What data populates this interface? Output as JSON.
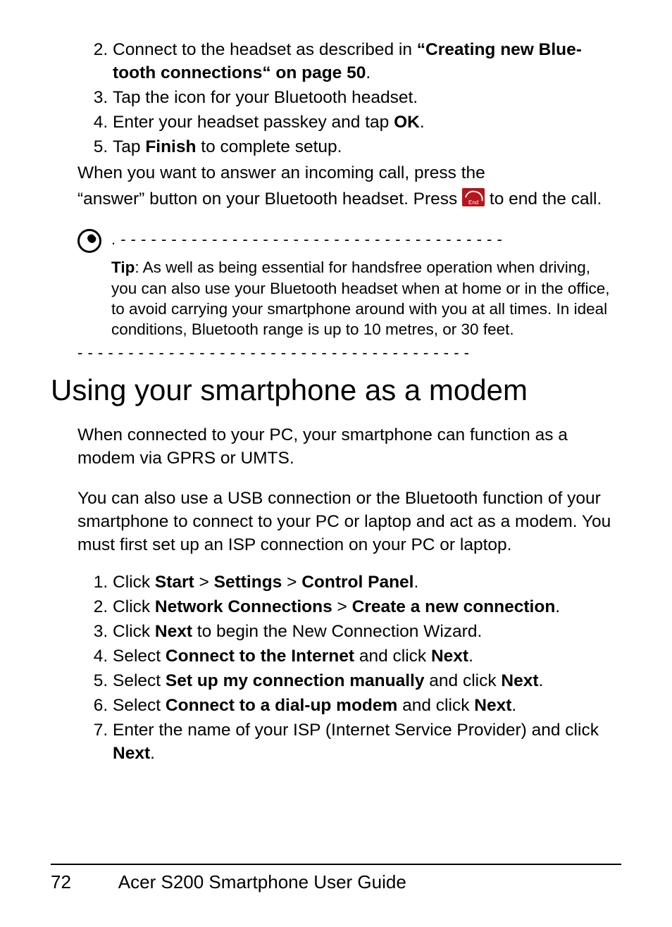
{
  "steps_top": {
    "s2_pre": "Connect to the headset as described in ",
    "s2_bold": "“Creating new Blue­tooth connections“ on page 50",
    "s2_post": ".",
    "s3": "Tap the icon for your Bluetooth headset.",
    "s4_pre": "Enter your headset passkey and tap ",
    "s4_bold": "OK",
    "s4_post": ".",
    "s5_pre": "Tap ",
    "s5_bold": "Finish",
    "s5_post": " to complete setup."
  },
  "paras": {
    "p1": "When you want to answer an incoming call, press the",
    "p2_pre": "“answer” button on your Bluetooth headset. Press ",
    "p2_post": " to end the call."
  },
  "tip": {
    "dashes_top": ". - - - - - - - - - - - - - - - - - - - - - - - - - - - - - - - - - - - - - -",
    "label": "Tip",
    "body": ": As well as being essential for handsfree operation when driv­ing, you can also use your Bluetooth headset when at home or in the office, to avoid carrying your smartphone around with you at all times. In ideal conditions, Bluetooth range is up to 10 metres, or 30 feet.",
    "dashes_bot": "- - - - - - - - - - - - - - - - - - - - - - - - - - - - - - - - - - - - - - -"
  },
  "heading": "Using your smartphone as a modem",
  "modem": {
    "p1": "When connected to your PC, your smartphone can function as a modem via GPRS or UMTS.",
    "p2": "You can also use a USB connection or the Bluetooth function of your smartphone to connect to your PC or laptop and act as a modem. You must first set up an ISP connection on your PC or laptop."
  },
  "steps_bottom": {
    "s1_pre": "Click ",
    "s1_b1": "Start",
    "s1_m1": " > ",
    "s1_b2": "Settings",
    "s1_m2": " > ",
    "s1_b3": "Control Panel",
    "s1_post": ".",
    "s2_pre": "Click ",
    "s2_b1": "Network Connections",
    "s2_m1": " > ",
    "s2_b2": "Create a new connection",
    "s2_post": ".",
    "s3_pre": "Click ",
    "s3_b1": "Next",
    "s3_post": " to begin the New Connection Wizard.",
    "s4_pre": "Select ",
    "s4_b1": "Connect to the Internet",
    "s4_m1": " and click ",
    "s4_b2": "Next",
    "s4_post": ".",
    "s5_pre": "Select ",
    "s5_b1": "Set up my connection manually",
    "s5_m1": " and click ",
    "s5_b2": "Next",
    "s5_post": ".",
    "s6_pre": "Select ",
    "s6_b1": "Connect to a dial-up modem",
    "s6_m1": " and click ",
    "s6_b2": "Next",
    "s6_post": ".",
    "s7_pre": "Enter the name of your ISP (Internet Service Provider) and click ",
    "s7_b1": "Next",
    "s7_post": "."
  },
  "footer": {
    "page": "72",
    "title": "Acer S200 Smartphone User Guide"
  }
}
